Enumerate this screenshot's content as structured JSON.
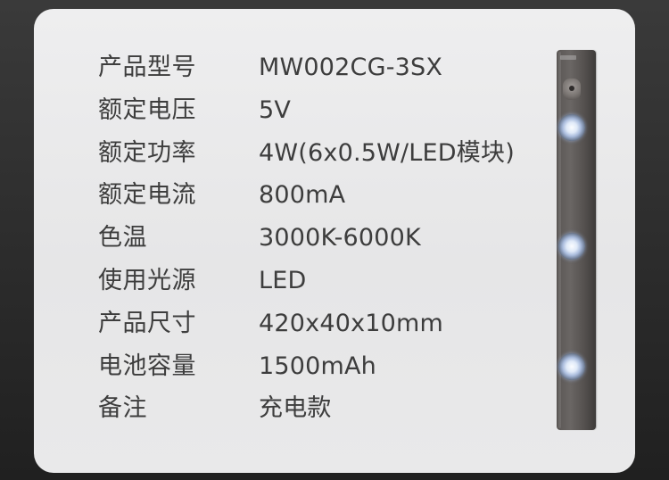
{
  "specs": [
    {
      "label": "产品型号",
      "value": "MW002CG-3SX"
    },
    {
      "label": "额定电压",
      "value": "5V"
    },
    {
      "label": "额定功率",
      "value": "4W(6x0.5W/LED模块)"
    },
    {
      "label": "额定电流",
      "value": "800mA"
    },
    {
      "label": "色温",
      "value": "3000K-6000K"
    },
    {
      "label": "使用光源",
      "value": "LED"
    },
    {
      "label": "产品尺寸",
      "value": "420x40x10mm"
    },
    {
      "label": "电池容量",
      "value": "1500mAh"
    },
    {
      "label": "备注",
      "value": "充电款"
    }
  ],
  "colors": {
    "card_background": "#ececed",
    "text": "#3d3d3d",
    "product_body": "#5f5b59",
    "led_glow": "#dfe9f8"
  },
  "icons": {
    "product": "led-light-bar-icon"
  }
}
